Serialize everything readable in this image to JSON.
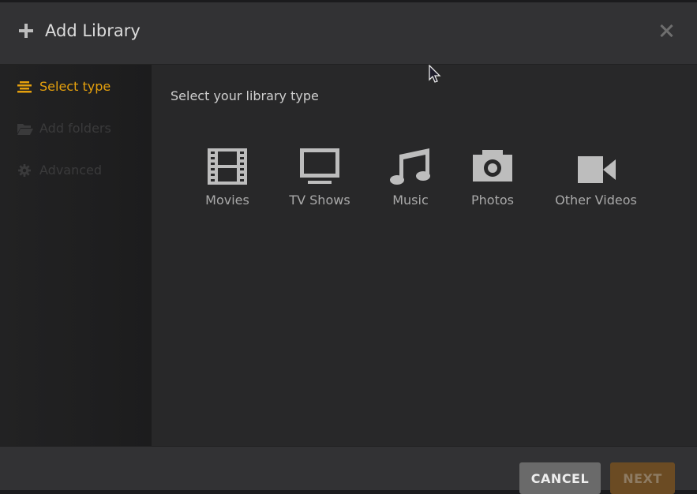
{
  "header": {
    "title": "Add Library",
    "add_icon": "plus-icon",
    "close_icon": "close-icon"
  },
  "sidebar": {
    "items": [
      {
        "label": "Select type",
        "icon": "list-icon",
        "state": "active"
      },
      {
        "label": "Add folders",
        "icon": "folder-icon",
        "state": "disabled"
      },
      {
        "label": "Advanced",
        "icon": "gear-icon",
        "state": "disabled"
      }
    ]
  },
  "main": {
    "prompt": "Select your library type",
    "library_types": [
      {
        "label": "Movies",
        "icon": "film-icon"
      },
      {
        "label": "TV Shows",
        "icon": "tv-icon"
      },
      {
        "label": "Music",
        "icon": "music-note-icon"
      },
      {
        "label": "Photos",
        "icon": "camera-icon"
      },
      {
        "label": "Other Videos",
        "icon": "video-camera-icon"
      }
    ]
  },
  "footer": {
    "cancel_label": "CANCEL",
    "next_label": "NEXT"
  },
  "colors": {
    "accent": "#e5a00d",
    "next_button": "#6b4b23",
    "cancel_button": "#6a6a6a"
  }
}
